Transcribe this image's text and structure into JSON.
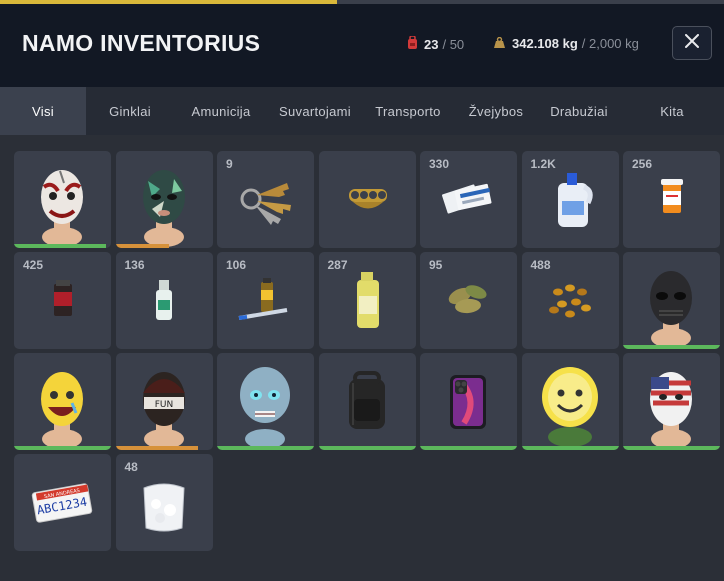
{
  "header": {
    "title": "NAMO INVENTORIUS",
    "slots_used": "23",
    "slots_max": "/ 50",
    "weight_current": "342.108 kg",
    "weight_max": "/ 2,000 kg",
    "progress_fraction": 0.465,
    "accent_color": "#d9b83a"
  },
  "tabs": [
    {
      "label": "Visi",
      "active": true
    },
    {
      "label": "Ginklai"
    },
    {
      "label": "Amunicija"
    },
    {
      "label": "Suvartojami"
    },
    {
      "label": "Transporto"
    },
    {
      "label": "Žvejybos"
    },
    {
      "label": "Drabužiai"
    },
    {
      "label": "Kita"
    }
  ],
  "items": [
    {
      "icon": "clown-mask-icon",
      "count": "",
      "durability": 0.95,
      "dcolor": "#5cb85c"
    },
    {
      "icon": "tropical-ski-mask-icon",
      "count": "",
      "durability": 0.55,
      "dcolor": "#d6913a"
    },
    {
      "icon": "keys-icon",
      "count": "9"
    },
    {
      "icon": "brass-knuckles-icon",
      "count": ""
    },
    {
      "icon": "paper-tickets-icon",
      "count": "330"
    },
    {
      "icon": "bleach-bottle-icon",
      "count": "1.2K"
    },
    {
      "icon": "pill-bottle-icon",
      "count": "256"
    },
    {
      "icon": "medicine-jar-icon",
      "count": "425"
    },
    {
      "icon": "vial-icon",
      "count": "136"
    },
    {
      "icon": "syringe-bottle-icon",
      "count": "106"
    },
    {
      "icon": "chemical-jug-icon",
      "count": "287"
    },
    {
      "icon": "leaves-icon",
      "count": "95"
    },
    {
      "icon": "seeds-icon",
      "count": "488"
    },
    {
      "icon": "dark-mask-icon",
      "count": "",
      "durability": 1.0,
      "dcolor": "#5cb85c"
    },
    {
      "icon": "smiley-mask-icon",
      "count": "",
      "durability": 1.0,
      "dcolor": "#5cb85c"
    },
    {
      "icon": "beanie-mask-icon",
      "count": "",
      "durability": 0.85,
      "dcolor": "#d6913a"
    },
    {
      "icon": "alien-mask-icon",
      "count": "",
      "durability": 1.0,
      "dcolor": "#5cb85c"
    },
    {
      "icon": "backpack-icon",
      "count": "",
      "durability": 1.0,
      "dcolor": "#5cb85c"
    },
    {
      "icon": "smartphone-icon",
      "count": "",
      "durability": 1.0,
      "dcolor": "#5cb85c"
    },
    {
      "icon": "lemon-mask-icon",
      "count": "",
      "durability": 1.0,
      "dcolor": "#5cb85c"
    },
    {
      "icon": "flag-mask-icon",
      "count": "",
      "durability": 1.0,
      "dcolor": "#5cb85c"
    },
    {
      "icon": "license-plate-icon",
      "count": "",
      "plate_text": "ABC1234",
      "plate_state": "SAN ANDREAS"
    },
    {
      "icon": "powder-bag-icon",
      "count": "48"
    }
  ]
}
